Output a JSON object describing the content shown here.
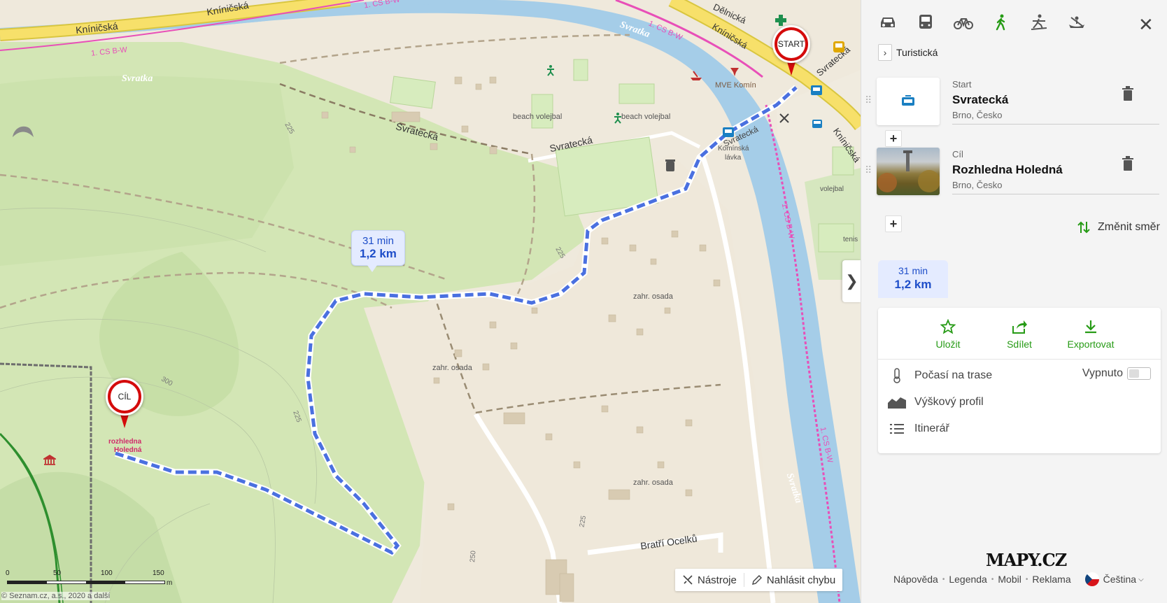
{
  "map": {
    "labels": {
      "knincska_1": "Kníničská",
      "knincska_2": "Kníničská",
      "knincska_3": "Kníničská",
      "knincska_4": "Kníničská",
      "delnicka": "Dělnická",
      "svratka_1": "Svratka",
      "svratka_2": "Svratka",
      "svratka_3": "Svratka",
      "svratka_4": "Svratka",
      "svratecka_1": "Svratecká",
      "svratecka_2": "Svratecká",
      "svratecka_3": "Svratecká",
      "svratecka_4": "Svratecká",
      "cs_1": "1. CS B-W",
      "cs_2": "1. CS B-W",
      "cs_3": "1. CS B-W",
      "cs_4": "1. CS B-W",
      "cs_5": "1. CS B-W",
      "mve": "MVE Komín",
      "kominska_1": "Komínská",
      "kominska_2": "lávka",
      "beach_1": "beach volejbal",
      "beach_2": "beach volejbal",
      "volejbal": "volejbal",
      "tenis": "tenis",
      "zahr_1": "zahr. osada",
      "zahr_2": "zahr. osada",
      "zahr_3": "zahr. osada",
      "bratri": "Bratří Ocelků",
      "rozhledna_1": "rozhledna",
      "rozhledna_2": "Holedná",
      "c225_1": "225",
      "c225_2": "225",
      "c225_3": "225",
      "c225_4": "225",
      "c250": "250",
      "c300": "300"
    },
    "start_pin": "START",
    "end_pin": "CÍL",
    "route_bubble": {
      "time": "31 min",
      "distance": "1,2 km"
    },
    "scale": {
      "t0": "0",
      "t50": "50",
      "t100": "100",
      "t150": "150",
      "unit": "m"
    },
    "copyright": "© Seznam.cz, a.s., 2020 a další",
    "toolbar": {
      "tools": "Nástroje",
      "report": "Nahlásit chybu"
    },
    "colors": {
      "route": "#4a70e0",
      "river": "#a5cde8",
      "forest": "#cfe4b1",
      "road": "#f7e06a",
      "cycle": "#e84fb8"
    }
  },
  "panel": {
    "modes": [
      "car-icon",
      "bus-icon",
      "bike-icon",
      "walk-icon",
      "ski-icon",
      "boat-icon"
    ],
    "active_mode": "walk",
    "profile": "Turistická",
    "start": {
      "type": "Start",
      "name": "Svratecká",
      "sub": "Brno, Česko"
    },
    "end": {
      "type": "Cíl",
      "name": "Rozhledna Holedná",
      "sub": "Brno, Česko"
    },
    "reverse": "Změnit směr",
    "summary": {
      "time": "31 min",
      "distance": "1,2 km"
    },
    "actions": {
      "save": "Uložit",
      "share": "Sdílet",
      "export": "Exportovat"
    },
    "options": {
      "weather": "Počasí na trase",
      "weather_state": "Vypnuto",
      "elevation": "Výškový profil",
      "itinerary": "Itinerář"
    },
    "logo": "MAPY.CZ",
    "footer": {
      "help": "Nápověda",
      "legend": "Legenda",
      "mobile": "Mobil",
      "ads": "Reklama",
      "lang": "Čeština"
    },
    "accent": "#279b16"
  }
}
